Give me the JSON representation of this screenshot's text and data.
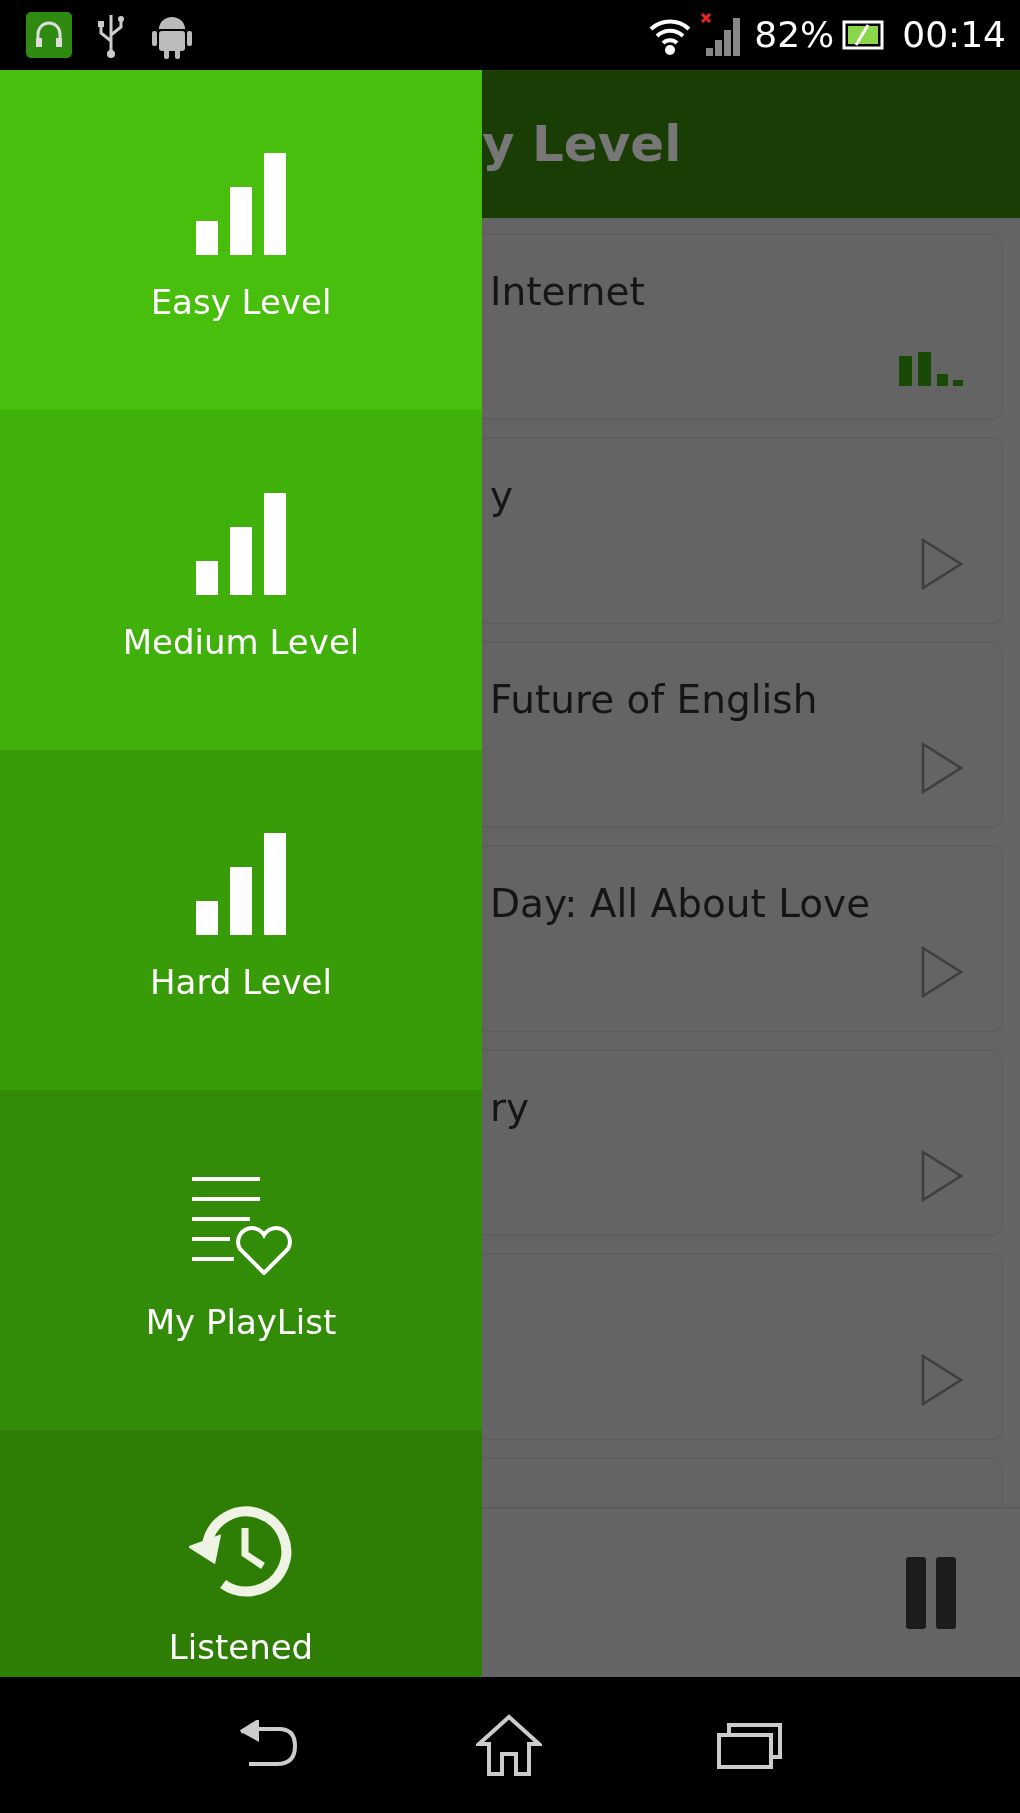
{
  "status_bar": {
    "battery": "82%",
    "time": "00:14"
  },
  "header": {
    "title": "y Level"
  },
  "tracks": [
    {
      "title": "Internet",
      "kind": "level"
    },
    {
      "title": "y",
      "kind": "play"
    },
    {
      "title": "Future of English",
      "kind": "play"
    },
    {
      "title": "Day: All About Love",
      "kind": "play"
    },
    {
      "title": "ry",
      "kind": "play"
    },
    {
      "kind": "play"
    },
    {
      "kind": "empty"
    }
  ],
  "player": {
    "playing": true
  },
  "drawer": {
    "items": [
      {
        "label": "Easy Level",
        "kind": "bars",
        "color": "#47bf0c"
      },
      {
        "label": "Medium Level",
        "kind": "bars",
        "color": "#40b10b"
      },
      {
        "label": "Hard Level",
        "kind": "bars",
        "color": "#389c08"
      },
      {
        "label": "My PlayList",
        "kind": "playlist",
        "color": "#338c07"
      },
      {
        "label": "Listened",
        "kind": "history",
        "color": "#2e7e06"
      }
    ]
  }
}
